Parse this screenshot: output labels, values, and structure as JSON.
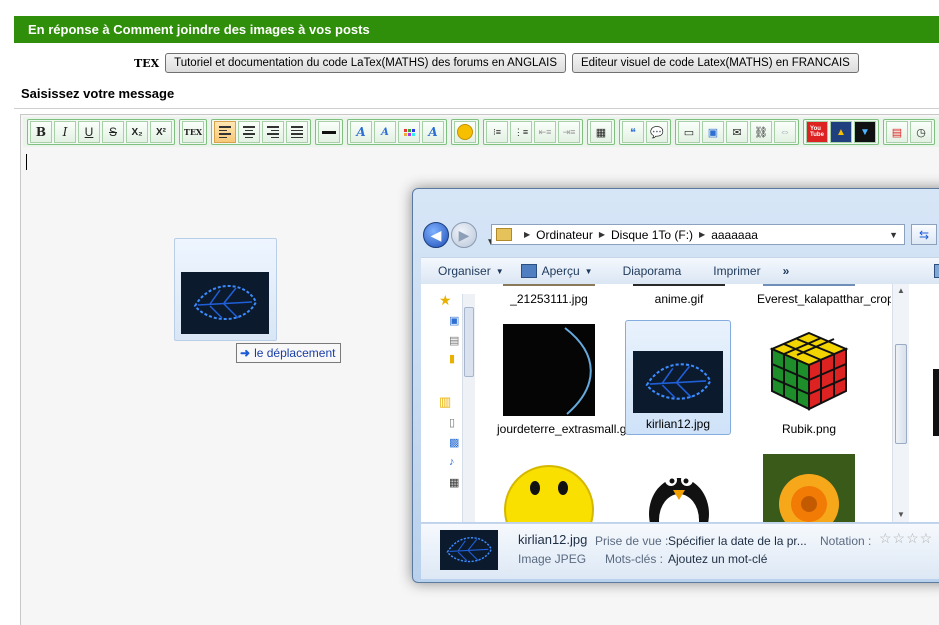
{
  "header": {
    "title": "En réponse à Comment joindre des images à vos posts"
  },
  "latex": {
    "logo": "TEX",
    "tutorial_button": "Tutoriel et documentation du code LaTex(MATHS) des forums en ANGLAIS",
    "editor_button": "Editeur visuel de code Latex(MATHS) en FRANCAIS"
  },
  "message": {
    "label": "Saisissez votre message"
  },
  "toolbar": {
    "bold": "B",
    "italic": "I",
    "underline": "U",
    "strike": "S",
    "sub": "X₂",
    "sup": "X²",
    "tex": "TEX"
  },
  "drag": {
    "tooltip": "le déplacement"
  },
  "explorer": {
    "breadcrumb": [
      "Ordinateur",
      "Disque 1To (F:)",
      "aaaaaaa"
    ],
    "commands": {
      "organize": "Organiser",
      "preview": "Aperçu",
      "slideshow": "Diaporama",
      "print": "Imprimer",
      "more": "»"
    },
    "files": [
      {
        "name": "_21253111.jpg"
      },
      {
        "name": "anime.gif"
      },
      {
        "name": "Everest_kalapatthar_crop.jpg"
      },
      {
        "name": "jourdeterre_extrasmall.gif"
      },
      {
        "name": "kirlian12.jpg"
      },
      {
        "name": "Rubik.png"
      },
      {
        "name": ""
      },
      {
        "name": ""
      },
      {
        "name": ""
      }
    ],
    "details": {
      "filename": "kirlian12.jpg",
      "type": "Image JPEG",
      "taken_label": "Prise de vue :",
      "taken_value": "Spécifier la date de la pr...",
      "keywords_label": "Mots-clés :",
      "keywords_value": "Ajoutez un mot-clé",
      "rating_label": "Notation :"
    }
  }
}
